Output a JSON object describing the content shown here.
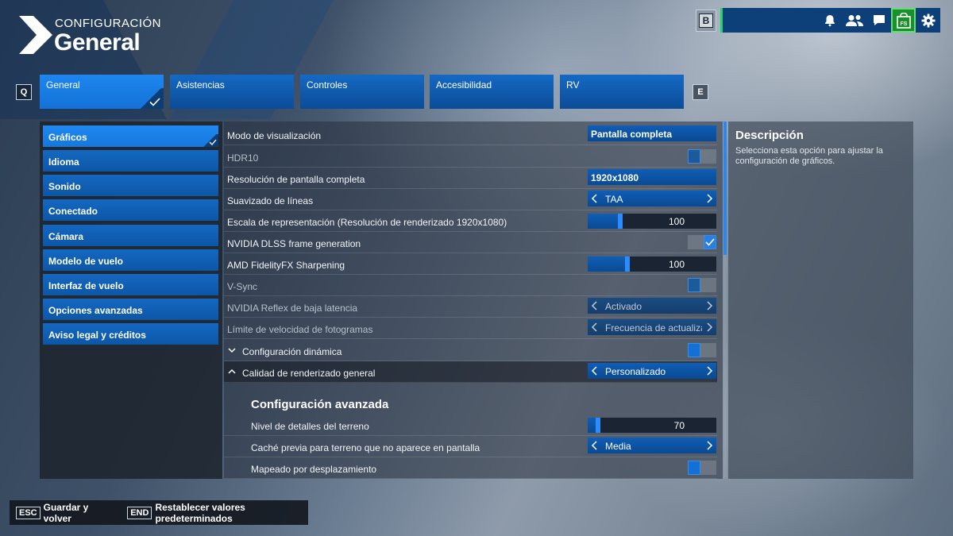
{
  "header": {
    "subtitle": "CONFIGURACIÓN",
    "title": "General"
  },
  "topbar": {
    "back_key": "B"
  },
  "tabs": {
    "prev_key": "Q",
    "next_key": "E",
    "items": [
      {
        "label": "General",
        "active": true
      },
      {
        "label": "Asistencias"
      },
      {
        "label": "Controles"
      },
      {
        "label": "Accesibilidad"
      },
      {
        "label": "RV"
      }
    ]
  },
  "sidebar": {
    "items": [
      {
        "label": "Gráficos",
        "active": true
      },
      {
        "label": "Idioma"
      },
      {
        "label": "Sonido"
      },
      {
        "label": "Conectado"
      },
      {
        "label": "Cámara"
      },
      {
        "label": "Modelo de vuelo"
      },
      {
        "label": "Interfaz de vuelo"
      },
      {
        "label": "Opciones avanzadas"
      },
      {
        "label": "Aviso legal y créditos"
      }
    ]
  },
  "settings": {
    "rows": [
      {
        "label": "Modo de visualización",
        "value": "Pantalla completa"
      },
      {
        "label": "HDR10"
      },
      {
        "label": "Resolución de pantalla completa",
        "value": "1920x1080"
      },
      {
        "label": "Suavizado de líneas",
        "value": "TAA"
      },
      {
        "label": "Escala de representación (Resolución de renderizado 1920x1080)",
        "value": "100",
        "level": 0.25
      },
      {
        "label": "NVIDIA DLSS frame generation",
        "checked": true
      },
      {
        "label": "AMD FidelityFX Sharpening",
        "value": "100",
        "level": 0.31
      },
      {
        "label": "V-Sync",
        "checked": false
      },
      {
        "label": "NVIDIA Reflex de baja latencia",
        "value": "Activado"
      },
      {
        "label": "Límite de velocidad de fotogramas",
        "value": "Frecuencia de actualización"
      },
      {
        "label": "Configuración dinámica",
        "checked": false
      },
      {
        "label": "Calidad de renderizado general",
        "value": "Personalizado"
      }
    ],
    "advanced": {
      "title": "Configuración avanzada",
      "rows": [
        {
          "label": "Nivel de detalles del terreno",
          "value": "70",
          "level": 0.08
        },
        {
          "label": "Caché previa para terreno que no aparece en pantalla",
          "value": "Media"
        },
        {
          "label": "Mapeado por desplazamiento",
          "checked": false
        }
      ]
    }
  },
  "description": {
    "title": "Descripción",
    "text": "Selecciona esta opción para ajustar la configuración de gráficos."
  },
  "footer": {
    "save_key": "ESC",
    "save_label": "Guardar y volver",
    "reset_key": "END",
    "reset_label": "Restablecer valores predeterminados"
  },
  "colors": {
    "accent": "#1e86ef",
    "tab": "#0b4c97",
    "shop": "#1a8f2c",
    "profile_accent": "#23d36b"
  }
}
